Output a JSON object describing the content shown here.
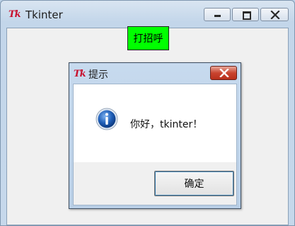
{
  "main_window": {
    "logo_text": "Tk",
    "title": "Tkinter",
    "greet_button_label": "打招呼"
  },
  "dialog": {
    "logo_text": "Tk",
    "title": "提示",
    "message": "你好，tkinter！",
    "ok_label": "确定",
    "icon": "info-icon"
  },
  "colors": {
    "greet_button_bg": "#00ff00",
    "close_button": "#c9442f",
    "info_icon": "#1f5fb8"
  }
}
